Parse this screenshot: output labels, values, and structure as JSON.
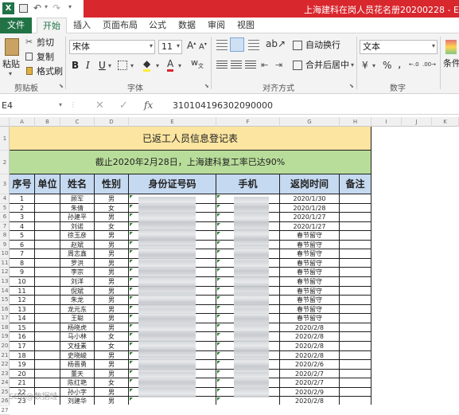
{
  "window": {
    "title": "上海建科在岗人员花名册20200228 - Exce"
  },
  "tabs": [
    "文件",
    "开始",
    "插入",
    "页面布局",
    "公式",
    "数据",
    "审阅",
    "视图"
  ],
  "ribbon": {
    "clipboard": {
      "paste": "粘贴",
      "cut": "剪切",
      "copy": "复制",
      "format_painter": "格式刷",
      "label": "剪贴板"
    },
    "font": {
      "name": "宋体",
      "size": "11",
      "label": "字体"
    },
    "alignment": {
      "wrap": "自动换行",
      "merge": "合并后居中",
      "label": "对齐方式"
    },
    "number": {
      "format": "文本",
      "label": "数字"
    },
    "styles": {
      "conditional": "条件"
    }
  },
  "formula_bar": {
    "cell_ref": "E4",
    "fx": "fx",
    "value": "310104196302090000"
  },
  "columns": [
    "A",
    "B",
    "C",
    "D",
    "E",
    "F",
    "G",
    "H",
    "I",
    "J",
    "K"
  ],
  "rows": [
    "1",
    "2",
    "3",
    "4",
    "5",
    "6",
    "7",
    "8",
    "9",
    "10",
    "11",
    "12",
    "13",
    "14",
    "15",
    "16",
    "17",
    "18",
    "19",
    "20",
    "21",
    "22",
    "23",
    "24",
    "25",
    "26",
    "27"
  ],
  "sheet": {
    "title": "已返工人员信息登记表",
    "subtitle": "截止2020年2月28日，上海建科复工率已达90%",
    "headers": [
      "序号",
      "单位",
      "姓名",
      "性别",
      "身份证号码",
      "手机",
      "返岗时间",
      "备注"
    ],
    "records": [
      {
        "no": "1",
        "name": "顾军",
        "gender": "男",
        "date": "2020/1/30"
      },
      {
        "no": "2",
        "name": "朱倩",
        "gender": "女",
        "date": "2020/1/28"
      },
      {
        "no": "3",
        "name": "孙建平",
        "gender": "男",
        "date": "2020/1/27"
      },
      {
        "no": "4",
        "name": "刘诺",
        "gender": "女",
        "date": "2020/1/27"
      },
      {
        "no": "5",
        "name": "徐玉彦",
        "gender": "男",
        "date": "春节留守"
      },
      {
        "no": "6",
        "name": "赵斌",
        "gender": "男",
        "date": "春节留守"
      },
      {
        "no": "7",
        "name": "周志鑫",
        "gender": "男",
        "date": "春节留守"
      },
      {
        "no": "8",
        "name": "罗洪",
        "gender": "男",
        "date": "春节留守"
      },
      {
        "no": "9",
        "name": "李宗",
        "gender": "男",
        "date": "春节留守"
      },
      {
        "no": "10",
        "name": "刘洋",
        "gender": "男",
        "date": "春节留守"
      },
      {
        "no": "11",
        "name": "倪斌",
        "gender": "男",
        "date": "春节留守"
      },
      {
        "no": "12",
        "name": "朱龙",
        "gender": "男",
        "date": "春节留守"
      },
      {
        "no": "13",
        "name": "龙元东",
        "gender": "男",
        "date": "春节留守"
      },
      {
        "no": "14",
        "name": "王聪",
        "gender": "男",
        "date": "春节留守"
      },
      {
        "no": "15",
        "name": "杨晓虎",
        "gender": "男",
        "date": "2020/2/8"
      },
      {
        "no": "16",
        "name": "马小林",
        "gender": "女",
        "date": "2020/2/8"
      },
      {
        "no": "17",
        "name": "文桂素",
        "gender": "女",
        "date": "2020/2/8"
      },
      {
        "no": "18",
        "name": "史晓峻",
        "gender": "男",
        "date": "2020/2/8"
      },
      {
        "no": "19",
        "name": "杨晋勇",
        "gender": "男",
        "date": "2020/2/6"
      },
      {
        "no": "20",
        "name": "董天",
        "gender": "男",
        "date": "2020/2/7"
      },
      {
        "no": "21",
        "name": "陈红艳",
        "gender": "女",
        "date": "2020/2/7"
      },
      {
        "no": "22",
        "name": "孙小字",
        "gender": "男",
        "date": "2020/2/9"
      },
      {
        "no": "23",
        "name": "刘建华",
        "gender": "男",
        "date": "2020/2/8"
      }
    ]
  },
  "watermark": "CSDN@数据蛙",
  "colors": {
    "title_bg": "#fbe5a0",
    "subtitle_bg": "#b8dd9a",
    "header_bg": "#c5d9f1",
    "brand_red": "#d9272e",
    "file_tab": "#217346"
  }
}
